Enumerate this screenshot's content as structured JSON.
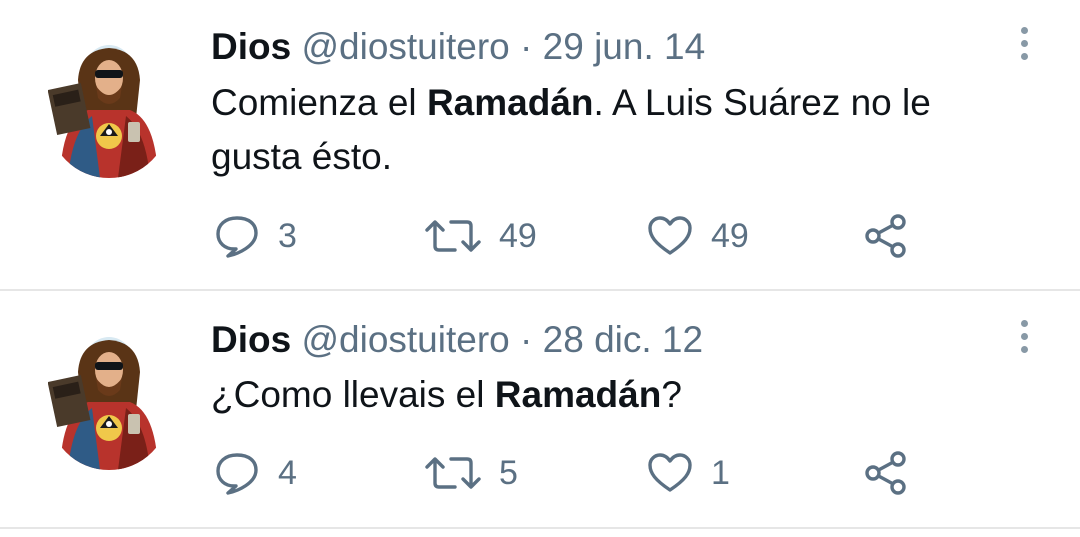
{
  "tweets": [
    {
      "author_name": "Dios",
      "handle": "@diostuitero",
      "separator": "·",
      "date": "29 jun. 14",
      "text_parts": [
        {
          "text": "Comienza el ",
          "bold": false
        },
        {
          "text": "Ramadán",
          "bold": true
        },
        {
          "text": ". A Luis Suárez no le gusta ésto.",
          "bold": false
        }
      ],
      "replies": "3",
      "retweets": "49",
      "likes": "49"
    },
    {
      "author_name": "Dios",
      "handle": "@diostuitero",
      "separator": "·",
      "date": "28 dic. 12",
      "text_parts": [
        {
          "text": "¿Como llevais el ",
          "bold": false
        },
        {
          "text": "Ramadán",
          "bold": true
        },
        {
          "text": "?",
          "bold": false
        }
      ],
      "replies": "4",
      "retweets": "5",
      "likes": "1"
    }
  ],
  "icons": {
    "reply": "speech-bubble-icon",
    "retweet": "retweet-icon",
    "like": "heart-icon",
    "share": "share-icon",
    "more": "more-vertical-icon"
  },
  "colors": {
    "text": "#0f1419",
    "muted": "#5b7083",
    "divider": "#e6e6e6"
  }
}
